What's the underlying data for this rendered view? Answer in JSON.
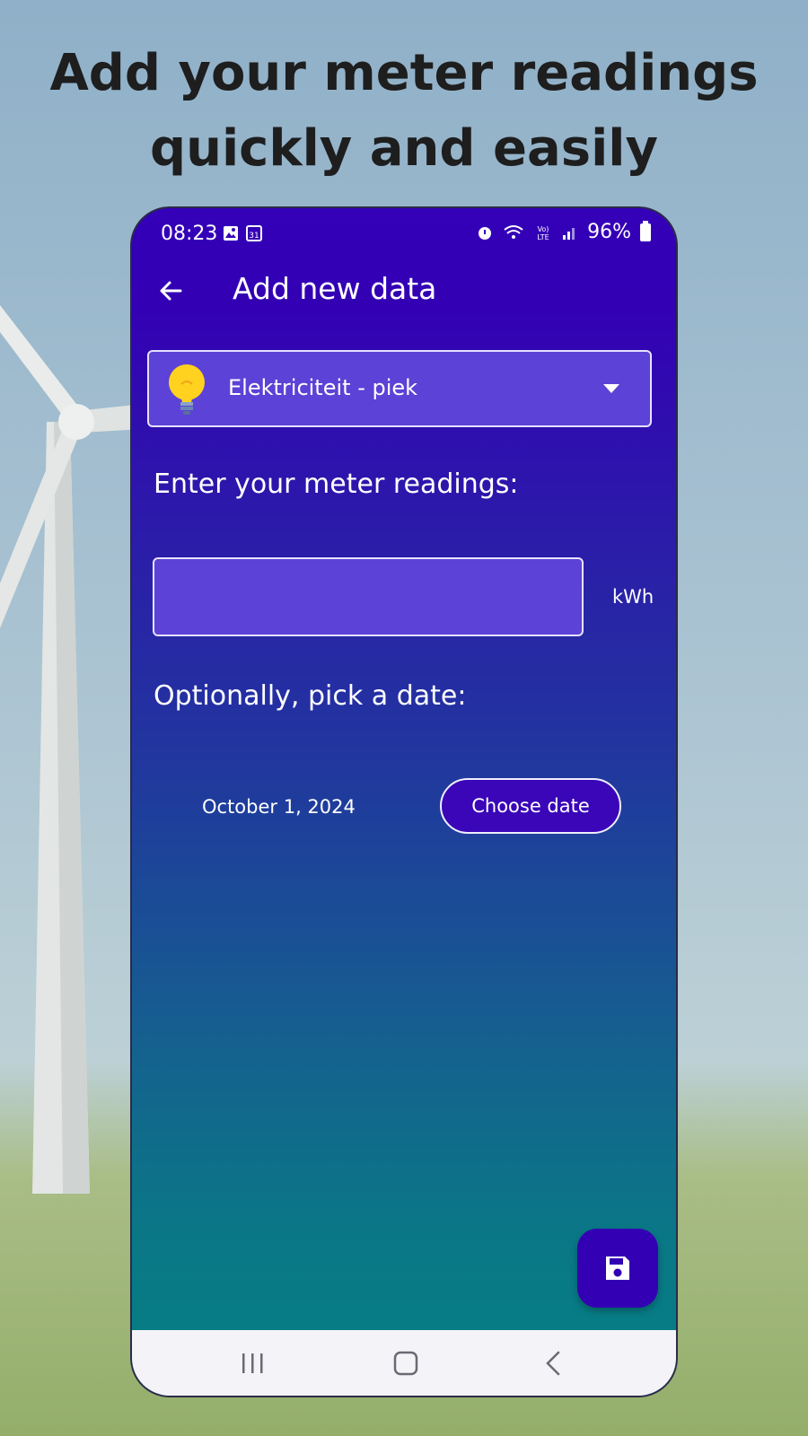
{
  "headline": {
    "line1": "Add your meter readings",
    "line2": "quickly and easily"
  },
  "status_bar": {
    "time": "08:23",
    "battery": "96%",
    "left_icons": [
      "image-icon",
      "calendar-icon"
    ],
    "right_icons": [
      "alarm-icon",
      "wifi-icon",
      "volte-icon",
      "signal-icon",
      "battery-icon"
    ]
  },
  "app_bar": {
    "title": "Add new data",
    "back_icon": "arrow-left-icon"
  },
  "meter_type_dropdown": {
    "icon": "lightbulb-icon",
    "selected": "Elektriciteit - piek"
  },
  "readings": {
    "label": "Enter your meter readings:",
    "value": "",
    "unit": "kWh"
  },
  "date": {
    "label": "Optionally, pick a date:",
    "value": "October 1, 2024",
    "button_label": "Choose date"
  },
  "fab": {
    "icon": "save-icon"
  },
  "nav_bar": {
    "items": [
      "recent-apps-icon",
      "home-icon",
      "back-icon"
    ]
  },
  "colors": {
    "primary": "#3300b4",
    "field_fill": "#5c42d6",
    "gradient_bottom": "#048083",
    "headline_text": "#1e1e1e"
  }
}
